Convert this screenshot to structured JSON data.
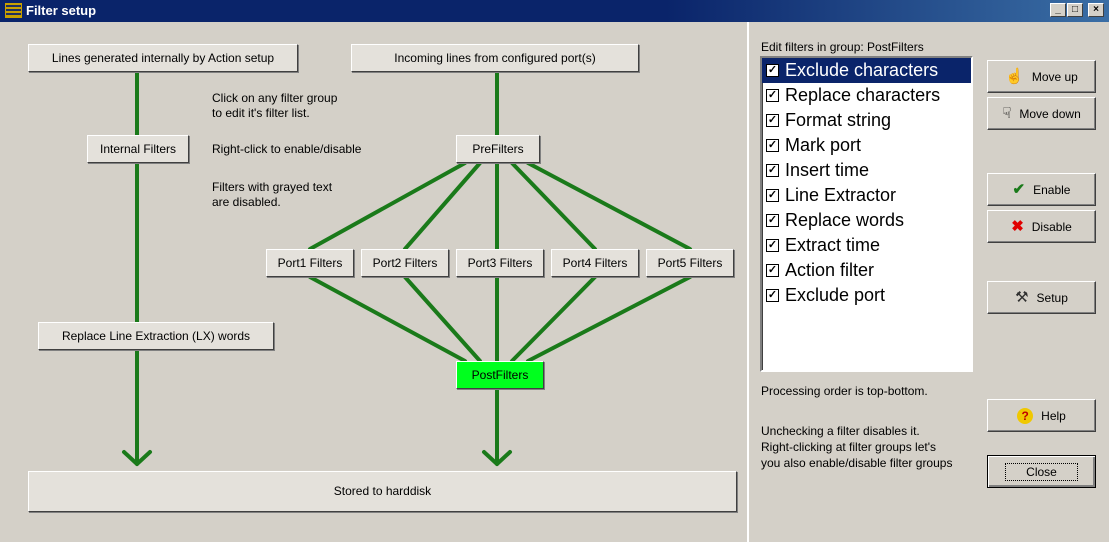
{
  "window": {
    "title": "Filter setup",
    "min_label": "_",
    "max_label": "□",
    "close_label": "×"
  },
  "diagram": {
    "internal_source": "Lines generated internally by Action setup",
    "incoming_source": "Incoming lines from configured port(s)",
    "internal_filters": "Internal Filters",
    "pre_filters": "PreFilters",
    "port_filters": [
      "Port1 Filters",
      "Port2 Filters",
      "Port3 Filters",
      "Port4 Filters",
      "Port5 Filters"
    ],
    "replace_lx": "Replace Line Extraction (LX) words",
    "post_filters": "PostFilters",
    "stored": "Stored to harddisk",
    "active_group": "PostFilters",
    "active_color": "#00ff1e",
    "line_color": "#1a7a1a",
    "notes": {
      "click": [
        "Click on any filter group",
        "to edit it's filter list."
      ],
      "right_click": "Right-click to enable/disable",
      "grayed": [
        "Filters with grayed text",
        "are disabled."
      ]
    }
  },
  "panel": {
    "caption": "Edit filters in group: PostFilters",
    "filters": [
      {
        "label": "Exclude characters",
        "checked": true,
        "selected": true
      },
      {
        "label": "Replace characters",
        "checked": true,
        "selected": false
      },
      {
        "label": "Format string",
        "checked": true,
        "selected": false
      },
      {
        "label": "Mark port",
        "checked": true,
        "selected": false
      },
      {
        "label": "Insert time",
        "checked": true,
        "selected": false
      },
      {
        "label": "Line Extractor",
        "checked": true,
        "selected": false
      },
      {
        "label": "Replace words",
        "checked": true,
        "selected": false
      },
      {
        "label": "Extract time",
        "checked": true,
        "selected": false
      },
      {
        "label": "Action filter",
        "checked": true,
        "selected": false
      },
      {
        "label": "Exclude port",
        "checked": true,
        "selected": false
      }
    ],
    "processing_order": "Processing order is top-bottom.",
    "uncheck_hint": "Unchecking a filter disables it.",
    "rightclick_hint": [
      "Right-clicking at filter groups let's",
      "you also enable/disable filter groups"
    ]
  },
  "buttons": {
    "move_up": "Move up",
    "move_down": "Move down",
    "enable": "Enable",
    "disable": "Disable",
    "setup": "Setup",
    "help": "Help",
    "close": "Close",
    "icons": {
      "move_up": "hand-up-icon",
      "move_down": "hand-down-icon",
      "enable": "checkmark-icon",
      "disable": "red-x-icon",
      "setup": "wrench-icon",
      "help": "question-icon"
    }
  }
}
